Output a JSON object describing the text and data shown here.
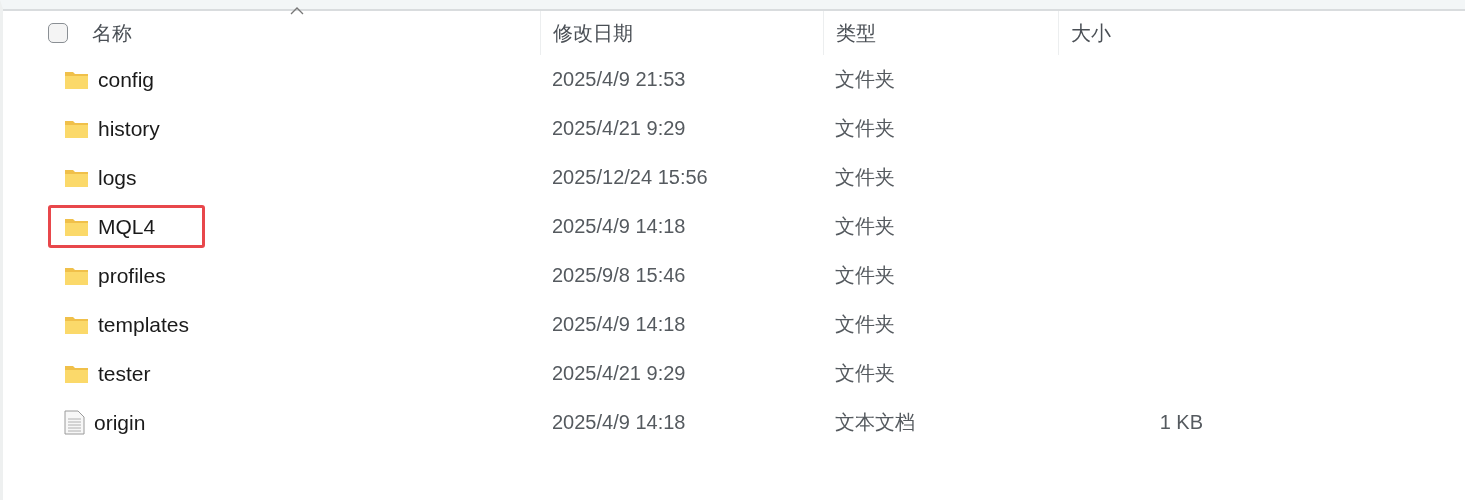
{
  "header": {
    "select_all": {
      "checked": false
    },
    "columns": [
      {
        "label": "名称",
        "sorted": true
      },
      {
        "label": "修改日期",
        "sorted": false
      },
      {
        "label": "类型",
        "sorted": false
      },
      {
        "label": "大小",
        "sorted": false
      }
    ]
  },
  "rows": [
    {
      "kind": "folder",
      "name": "config",
      "modified": "2025/4/9 21:53",
      "type": "文件夹",
      "highlighted": false
    },
    {
      "kind": "folder",
      "name": "history",
      "modified": "2025/4/21 9:29",
      "type": "文件夹",
      "highlighted": false
    },
    {
      "kind": "folder",
      "name": "logs",
      "modified": "2025/12/24 15:56",
      "type": "文件夹",
      "highlighted": false
    },
    {
      "kind": "folder",
      "name": "MQL4",
      "modified": "2025/4/9 14:18",
      "type": "文件夹",
      "highlighted": true
    },
    {
      "kind": "folder",
      "name": "profiles",
      "modified": "2025/9/8 15:46",
      "type": "文件夹",
      "highlighted": false
    },
    {
      "kind": "folder",
      "name": "templates",
      "modified": "2025/4/9 14:18",
      "type": "文件夹",
      "highlighted": false
    },
    {
      "kind": "folder",
      "name": "tester",
      "modified": "2025/4/21 9:29",
      "type": "文件夹",
      "highlighted": false
    },
    {
      "kind": "file",
      "name": "origin",
      "modified": "2025/4/9 14:18",
      "type": "文本文档",
      "size": "1 KB",
      "highlighted": false
    }
  ]
}
